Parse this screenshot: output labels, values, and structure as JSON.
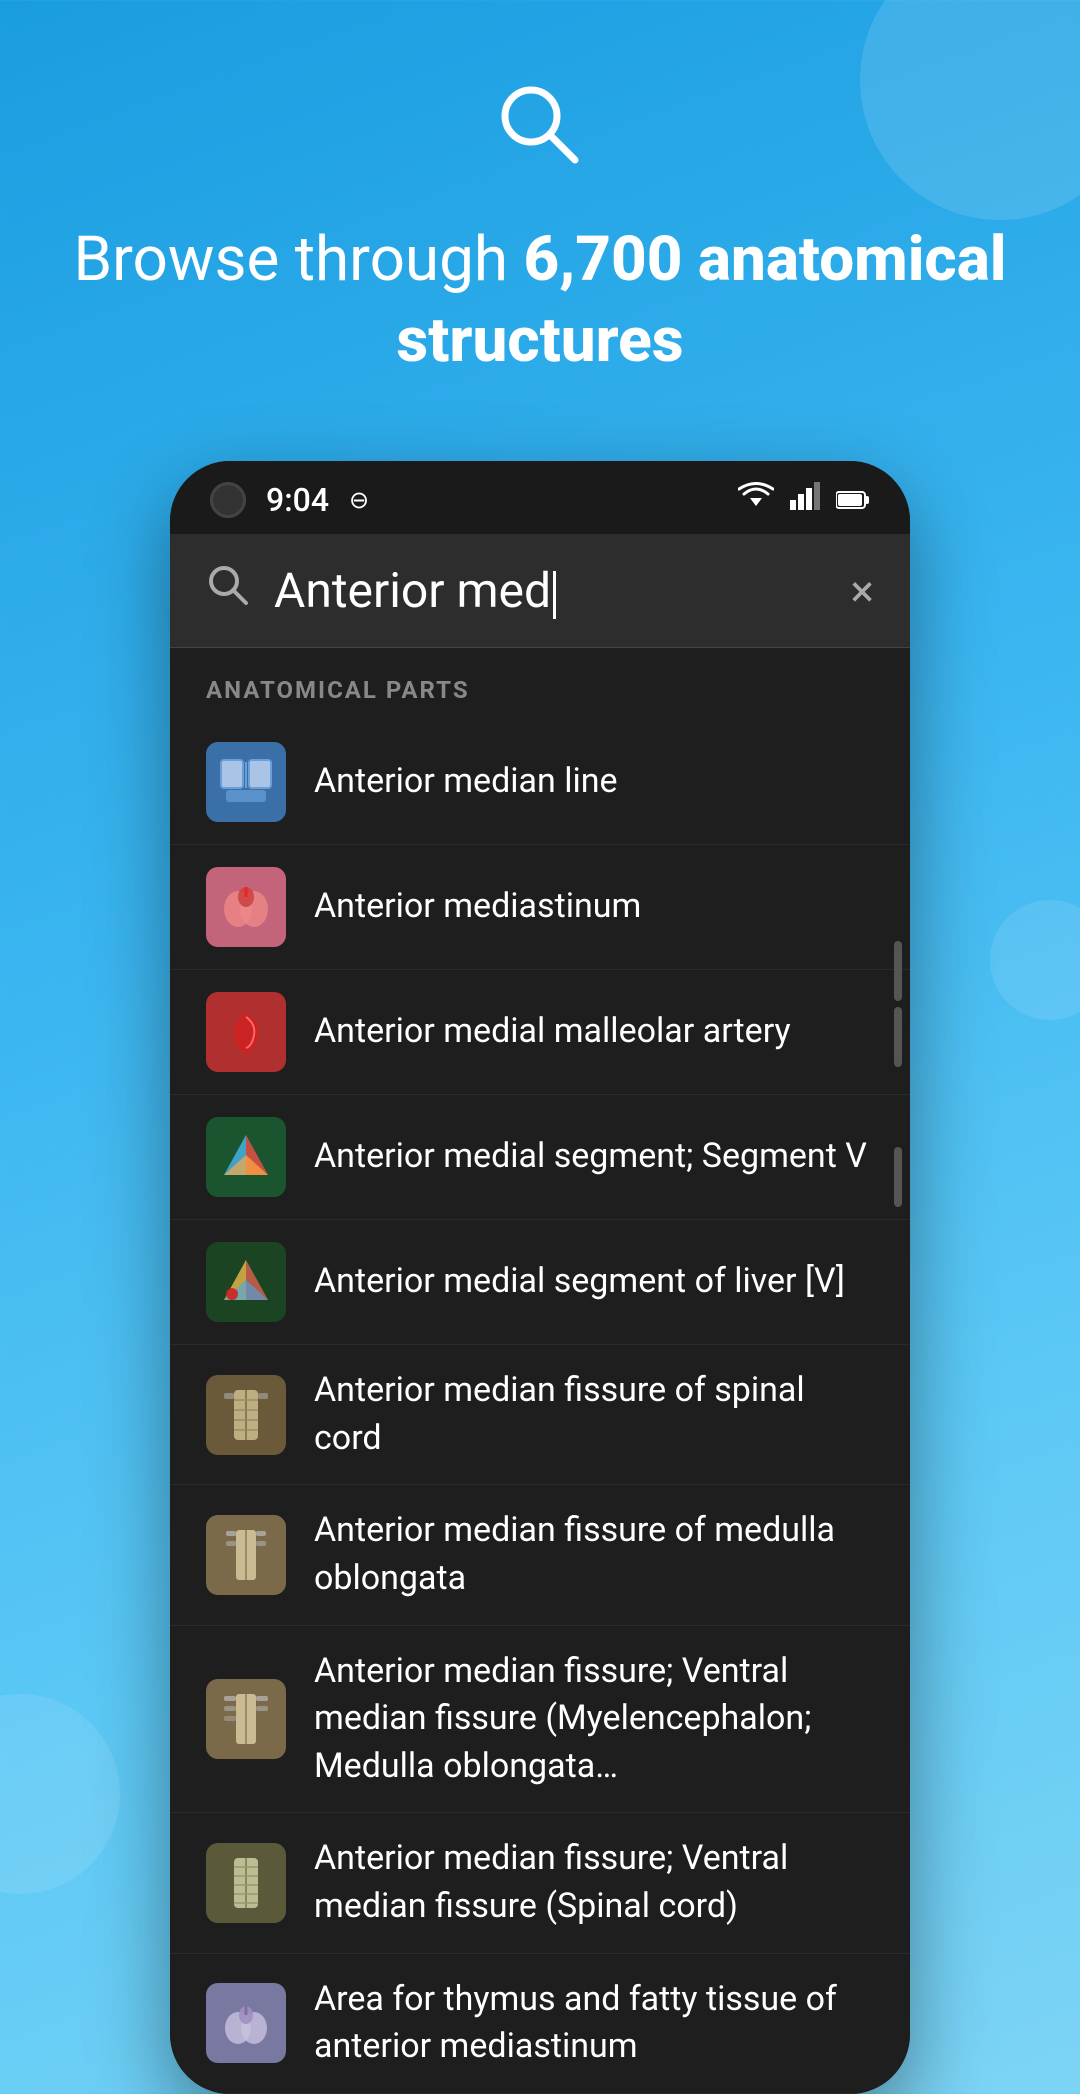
{
  "background": {
    "gradient_start": "#1a9de0",
    "gradient_end": "#7dd4f5"
  },
  "header": {
    "search_icon": "○",
    "title_normal": "Browse through ",
    "title_bold": "6,700 anatomical structures"
  },
  "status_bar": {
    "time": "9:04",
    "extra_icon": "⊖"
  },
  "search": {
    "placeholder": "Anterior med",
    "clear_label": "×",
    "search_icon_label": "🔍"
  },
  "section": {
    "label": "ANATOMICAL PARTS"
  },
  "results": [
    {
      "id": 1,
      "text": "Anterior median line",
      "thumb_type": "blue",
      "emoji": "📋"
    },
    {
      "id": 2,
      "text": "Anterior mediastinum",
      "thumb_type": "pink",
      "emoji": "🫁"
    },
    {
      "id": 3,
      "text": "Anterior medial malleolar artery",
      "thumb_type": "red",
      "emoji": "🩸"
    },
    {
      "id": 4,
      "text": "Anterior medial segment; Segment V",
      "thumb_type": "multicolor",
      "emoji": "🌈"
    },
    {
      "id": 5,
      "text": "Anterior medial segment of liver [V]",
      "thumb_type": "multicolor2",
      "emoji": "🌿"
    },
    {
      "id": 6,
      "text": "Anterior median fissure of spinal cord",
      "thumb_type": "spinal",
      "emoji": "🦴"
    },
    {
      "id": 7,
      "text": "Anterior median fissure of medulla oblongata",
      "thumb_type": "medulla",
      "emoji": "🧠"
    },
    {
      "id": 8,
      "text": "Anterior median fissure; Ventral median fissure (Myelencephalon; Medulla oblongata…",
      "thumb_type": "ventral",
      "emoji": "🧠"
    },
    {
      "id": 9,
      "text": "Anterior median fissure; Ventral median fissure (Spinal cord)",
      "thumb_type": "spinalcord",
      "emoji": "🦴"
    },
    {
      "id": 10,
      "text": "Area for thymus and fatty tissue of anterior mediastinum",
      "thumb_type": "thymus",
      "emoji": "🫁"
    }
  ],
  "scrollbar_items": [
    {
      "offset": 0
    },
    {
      "offset": 70
    },
    {
      "offset": 220
    }
  ]
}
